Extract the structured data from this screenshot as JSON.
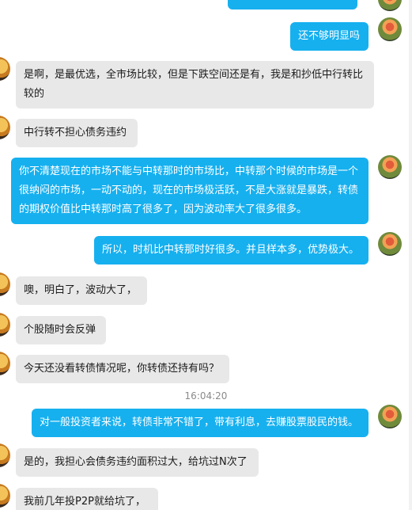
{
  "messages": [
    {
      "side": "out",
      "text": "还不够明显吗"
    },
    {
      "side": "in",
      "text": "是啊，是最优选，全市场比较，但是下跌空间还是有，我是和抄低中行转比较的"
    },
    {
      "side": "in",
      "text": "中行转不担心债务违约"
    },
    {
      "side": "out",
      "text": "你不清楚现在的市场不能与中转那时的市场比，中转那个时候的市场是一个很纳闷的市场，一动不动的，现在的市场极活跃，不是大涨就是暴跌，转债的期权价值比中转那时高了很多了，因为波动率大了很多很多。"
    },
    {
      "side": "out",
      "text": "所以，时机比中转那时好很多。并且样本多，优势极大。"
    },
    {
      "side": "in",
      "text": "噢，明白了，波动大了，"
    },
    {
      "side": "in",
      "text": "个股随时会反弹"
    },
    {
      "side": "in",
      "text": "今天还没看转债情况呢，你转债还持有吗？"
    },
    {
      "side": "out",
      "text": "对一般投资者来说，转债非常不错了，带有利息，去赚股票股民的钱。"
    },
    {
      "side": "in",
      "text": "是的，我担心会债务违约面积过大，给坑过N次了"
    },
    {
      "side": "in",
      "text": "我前几年投P2P就给坑了，"
    }
  ],
  "timestamp": "16:04:20",
  "colors": {
    "outgoing": "#16b0ef",
    "incoming": "#e8e8e8"
  }
}
